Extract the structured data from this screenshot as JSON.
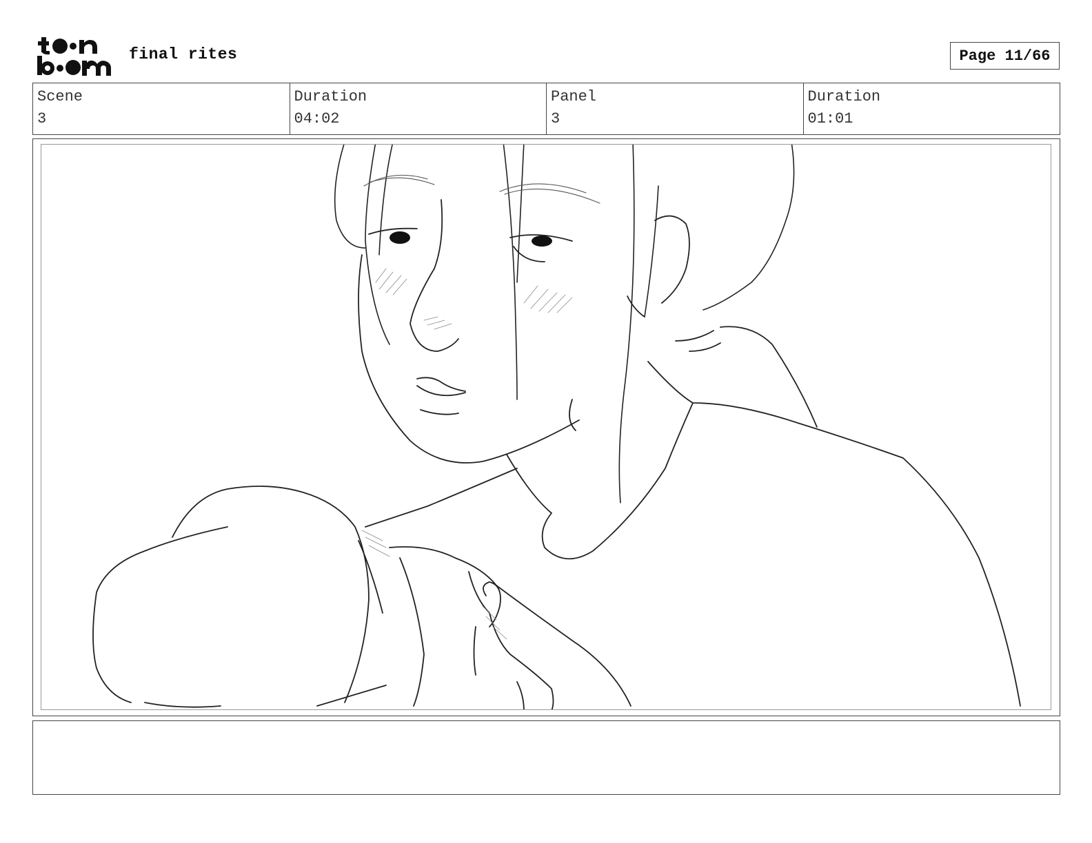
{
  "header": {
    "logo_text_top": "toon",
    "logo_text_bottom": "boom",
    "project_title": "final rites",
    "page_label": "Page 11/66"
  },
  "info": {
    "scene_label": "Scene",
    "scene_value": "3",
    "scene_duration_label": "Duration",
    "scene_duration_value": "04:02",
    "panel_label": "Panel",
    "panel_value": "3",
    "panel_duration_label": "Duration",
    "panel_duration_value": "01:01"
  },
  "panel": {
    "description": ""
  },
  "notes": {
    "text": ""
  }
}
